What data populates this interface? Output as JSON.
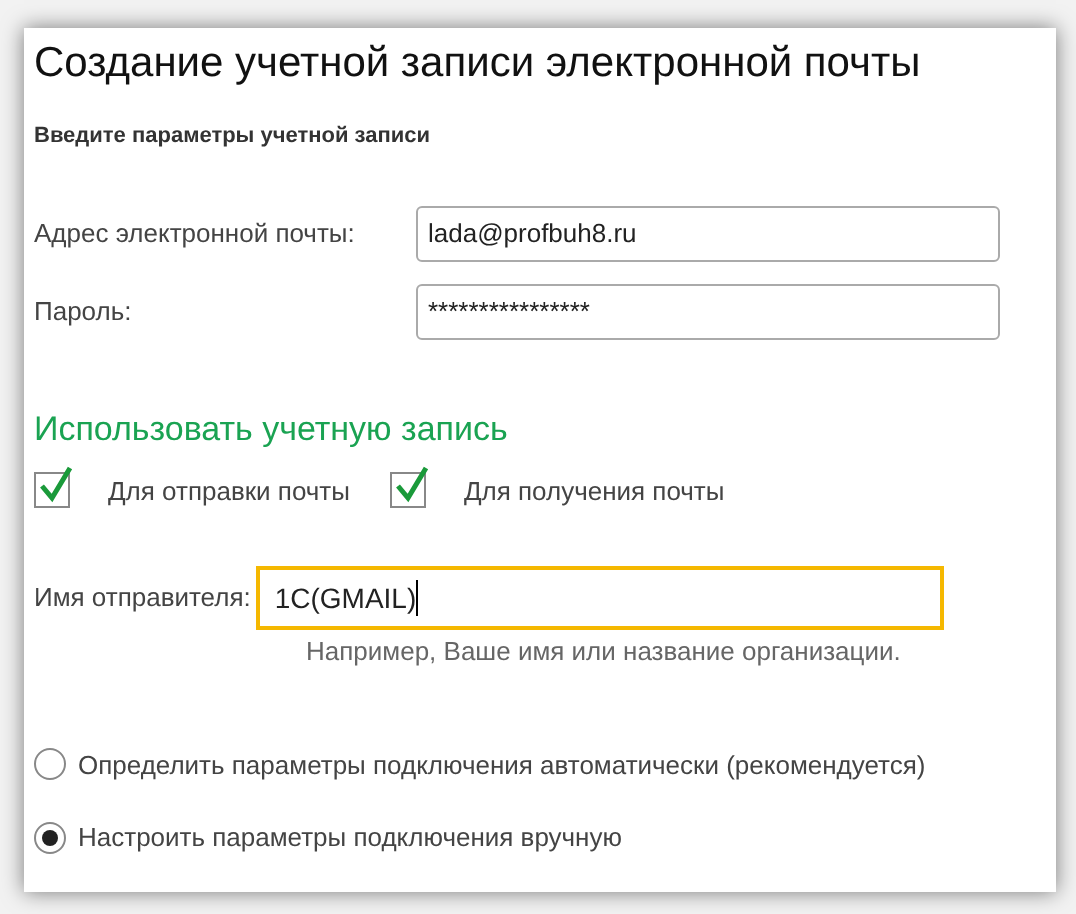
{
  "title": "Создание учетной записи электронной почты",
  "subtitle": "Введите параметры учетной записи",
  "account_fields": [
    {
      "label": "Адрес электронной почты:",
      "value": "lada@profbuh8.ru",
      "focused": false
    },
    {
      "label": "Пароль:",
      "value": "****************",
      "focused": false
    }
  ],
  "use_section": {
    "heading": "Использовать учетную запись",
    "checkboxes": [
      {
        "label": "Для отправки почты",
        "checked": true
      },
      {
        "label": "Для получения почты",
        "checked": true
      }
    ]
  },
  "sender": {
    "label": "Имя отправителя:",
    "value": "1C(GMAIL)",
    "focused": true,
    "hint": "Например, Ваше имя или название организации."
  },
  "connection_options": [
    {
      "label": "Определить параметры подключения автоматически (рекомендуется)",
      "selected": false
    },
    {
      "label": "Настроить параметры подключения вручную",
      "selected": true
    }
  ]
}
